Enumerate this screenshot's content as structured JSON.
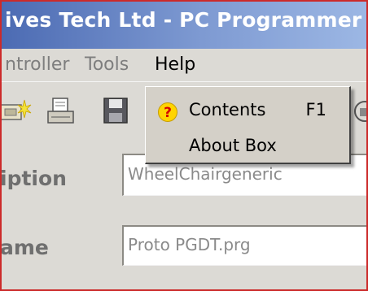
{
  "window": {
    "title": "ives Tech Ltd - PC Programmer"
  },
  "menubar": {
    "items": [
      {
        "label": "ntroller"
      },
      {
        "label": "Tools"
      },
      {
        "label": "Help"
      }
    ]
  },
  "help_menu": {
    "items": [
      {
        "label": "Contents",
        "shortcut": "F1",
        "icon": "help-question-icon"
      },
      {
        "label": "About Box",
        "shortcut": ""
      }
    ]
  },
  "toolbar": {
    "icons": [
      "program-icon",
      "print-icon",
      "save-icon",
      "remote-icon"
    ]
  },
  "form": {
    "description_label": "iption",
    "description_value": "WheelChairgeneric",
    "filename_label": "ame",
    "filename_value": "Proto PGDT.prg"
  },
  "colors": {
    "title_bar": "#4c6bb3",
    "window_bg": "#dcdad5",
    "frame_border": "#cc2a2a",
    "menu_bg": "#d4d0c8"
  }
}
